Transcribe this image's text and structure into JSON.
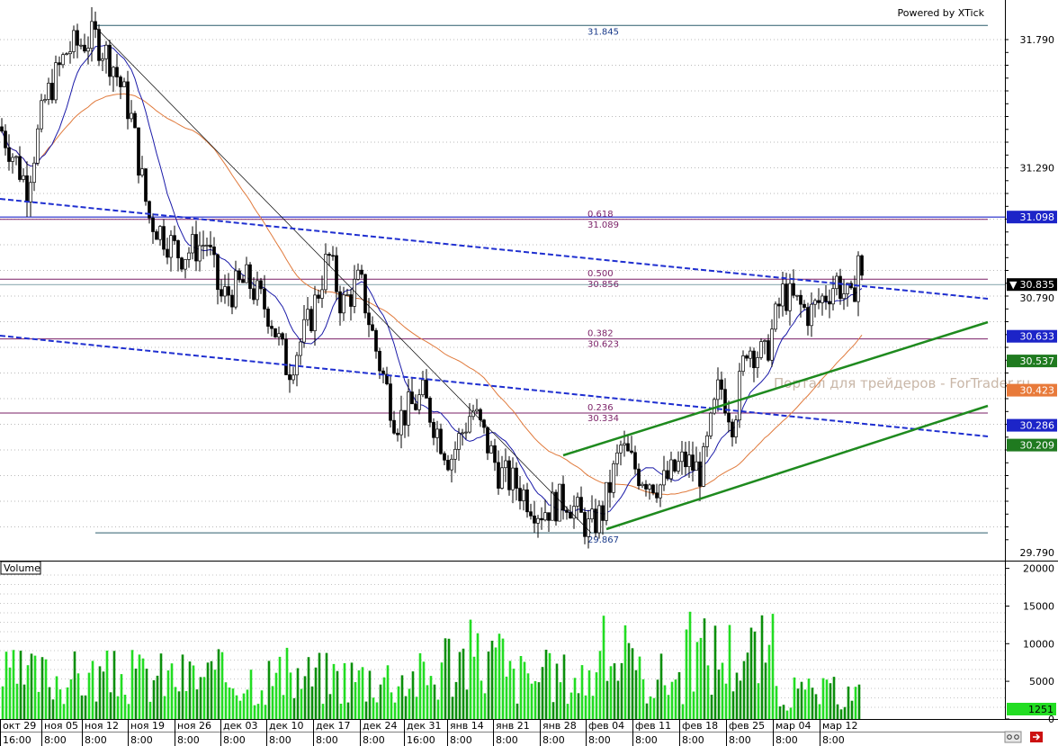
{
  "header": {
    "powered_by": "Powered by XTick"
  },
  "watermark": "Портал для трейдеров - ForTrader.ru",
  "volume_panel": {
    "label": "Volume",
    "current_volume": "1251"
  },
  "colors": {
    "candle_up": "#ffffff",
    "candle_down": "#000000",
    "ma_fast": "#1a1aa8",
    "ma_slow": "#e07a3c",
    "trend_blue": "#1f2fd0",
    "channel_green": "#1e8a1e",
    "fib_color": "#7a1f66",
    "volume_bar": "#22dd22",
    "volume_bar_dark": "#0b8f0b",
    "badge_blue": "#1c24c8",
    "badge_green": "#1f7a1f",
    "badge_orange": "#e87a3a",
    "badge_black": "#000000"
  },
  "chart_data": [
    {
      "type": "candlestick",
      "panel": "price",
      "y_axis_ticks": [
        "31.790",
        "31.290",
        "29.790"
      ],
      "ylim": [
        29.72,
        31.95
      ],
      "x_axis": {
        "date_labels": [
          "окт 29",
          "ноя 05",
          "ноя 12",
          "ноя 19",
          "ноя 26",
          "дек 03",
          "дек 10",
          "дек 17",
          "дек 24",
          "дек 31",
          "янв 14",
          "янв 21",
          "янв 28",
          "фев 04",
          "фев 11",
          "фев 18",
          "фев 25",
          "мар 04",
          "мар 12"
        ],
        "time_labels": [
          "16:00",
          "8:00",
          "8:00",
          "8:00",
          "8:00",
          "8:00",
          "8:00",
          "8:00",
          "8:00",
          "16:00",
          "8:00",
          "8:00",
          "8:00",
          "8:00",
          "8:00",
          "8:00",
          "8:00",
          "8:00",
          "8:00"
        ]
      },
      "fibonacci": {
        "high": 31.845,
        "low": 29.867,
        "levels": [
          {
            "ratio": "0.618",
            "value": "31.089"
          },
          {
            "ratio": "0.500",
            "value": "30.856"
          },
          {
            "ratio": "0.382",
            "value": "30.623"
          },
          {
            "ratio": "0.236",
            "value": "30.334"
          }
        ],
        "high_label": "31.845",
        "low_label": "29.867"
      },
      "price_badges": [
        {
          "value": "31.098",
          "color": "blue"
        },
        {
          "value": "30.835",
          "color": "black",
          "marker": "▼"
        },
        {
          "value": "30.633",
          "color": "blue"
        },
        {
          "value": "30.537",
          "color": "green"
        },
        {
          "value": "30.423",
          "color": "orange"
        },
        {
          "value": "30.286",
          "color": "blue"
        },
        {
          "value": "30.209",
          "color": "green"
        }
      ],
      "last_price": 30.835,
      "indicators": [
        "moving_average_fast",
        "moving_average_slow"
      ],
      "trendlines": [
        "descending_blue_dashed_upper",
        "descending_blue_dashed_lower",
        "ascending_green_channel_upper",
        "ascending_green_channel_lower"
      ]
    },
    {
      "type": "bar",
      "panel": "volume",
      "title": "Volume",
      "y_axis_ticks": [
        "20000",
        "15000",
        "10000",
        "5000",
        "0"
      ],
      "ylim": [
        0,
        20000
      ],
      "last_value": 1251
    }
  ]
}
